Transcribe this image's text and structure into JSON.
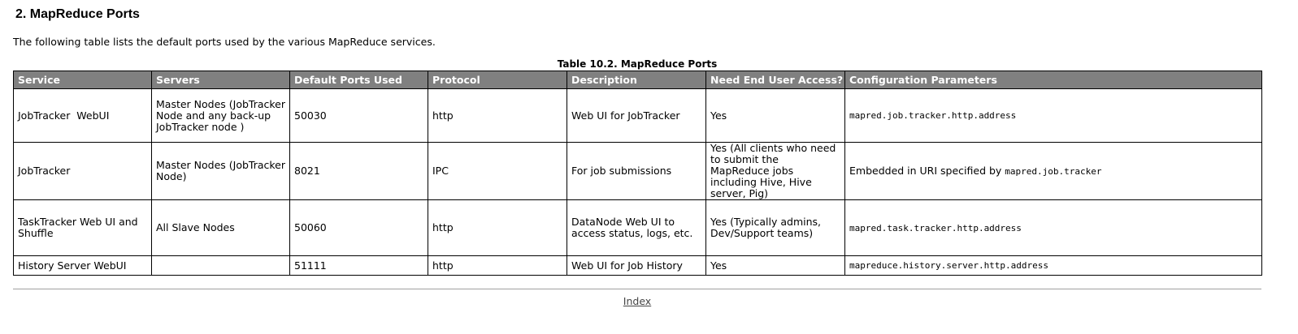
{
  "section": {
    "heading": "2. MapReduce Ports",
    "intro": "The following table lists the default ports used by the various MapReduce services."
  },
  "table": {
    "caption": "Table 10.2. MapReduce Ports",
    "headers": [
      "Service",
      "Servers",
      "Default Ports Used",
      "Protocol",
      "Description",
      "Need End User Access?",
      "Configuration Parameters"
    ],
    "rows": [
      {
        "service": "JobTracker  WebUI",
        "servers": "Master Nodes (JobTracker Node and any back-up JobTracker node )",
        "port": "50030",
        "protocol": "http",
        "description": "Web UI for JobTracker",
        "access": "Yes",
        "config_text": "",
        "config_code": "mapred.job.tracker.http.address"
      },
      {
        "service": "JobTracker",
        "servers": "Master Nodes (JobTracker Node)",
        "port": "8021",
        "protocol": "IPC",
        "description": "For job submissions",
        "access": "Yes (All clients who need to submit the MapReduce jobs  including Hive, Hive server, Pig)",
        "config_text": "Embedded in URI specified by ",
        "config_code": "mapred.job.tracker"
      },
      {
        "service": "TaskTracker Web UI and Shuffle",
        "servers": "All Slave Nodes",
        "port": "50060",
        "protocol": "http",
        "description": "DataNode Web UI to access status, logs, etc.",
        "access": "Yes (Typically admins, Dev/Support teams)",
        "config_text": "",
        "config_code": "mapred.task.tracker.http.address"
      },
      {
        "service": "History Server WebUI",
        "servers": "",
        "port": "51111",
        "protocol": "http",
        "description": "Web UI for Job History",
        "access": "Yes",
        "config_text": "",
        "config_code": "mapreduce.history.server.http.address"
      }
    ]
  },
  "footer": {
    "index_link": "Index"
  }
}
